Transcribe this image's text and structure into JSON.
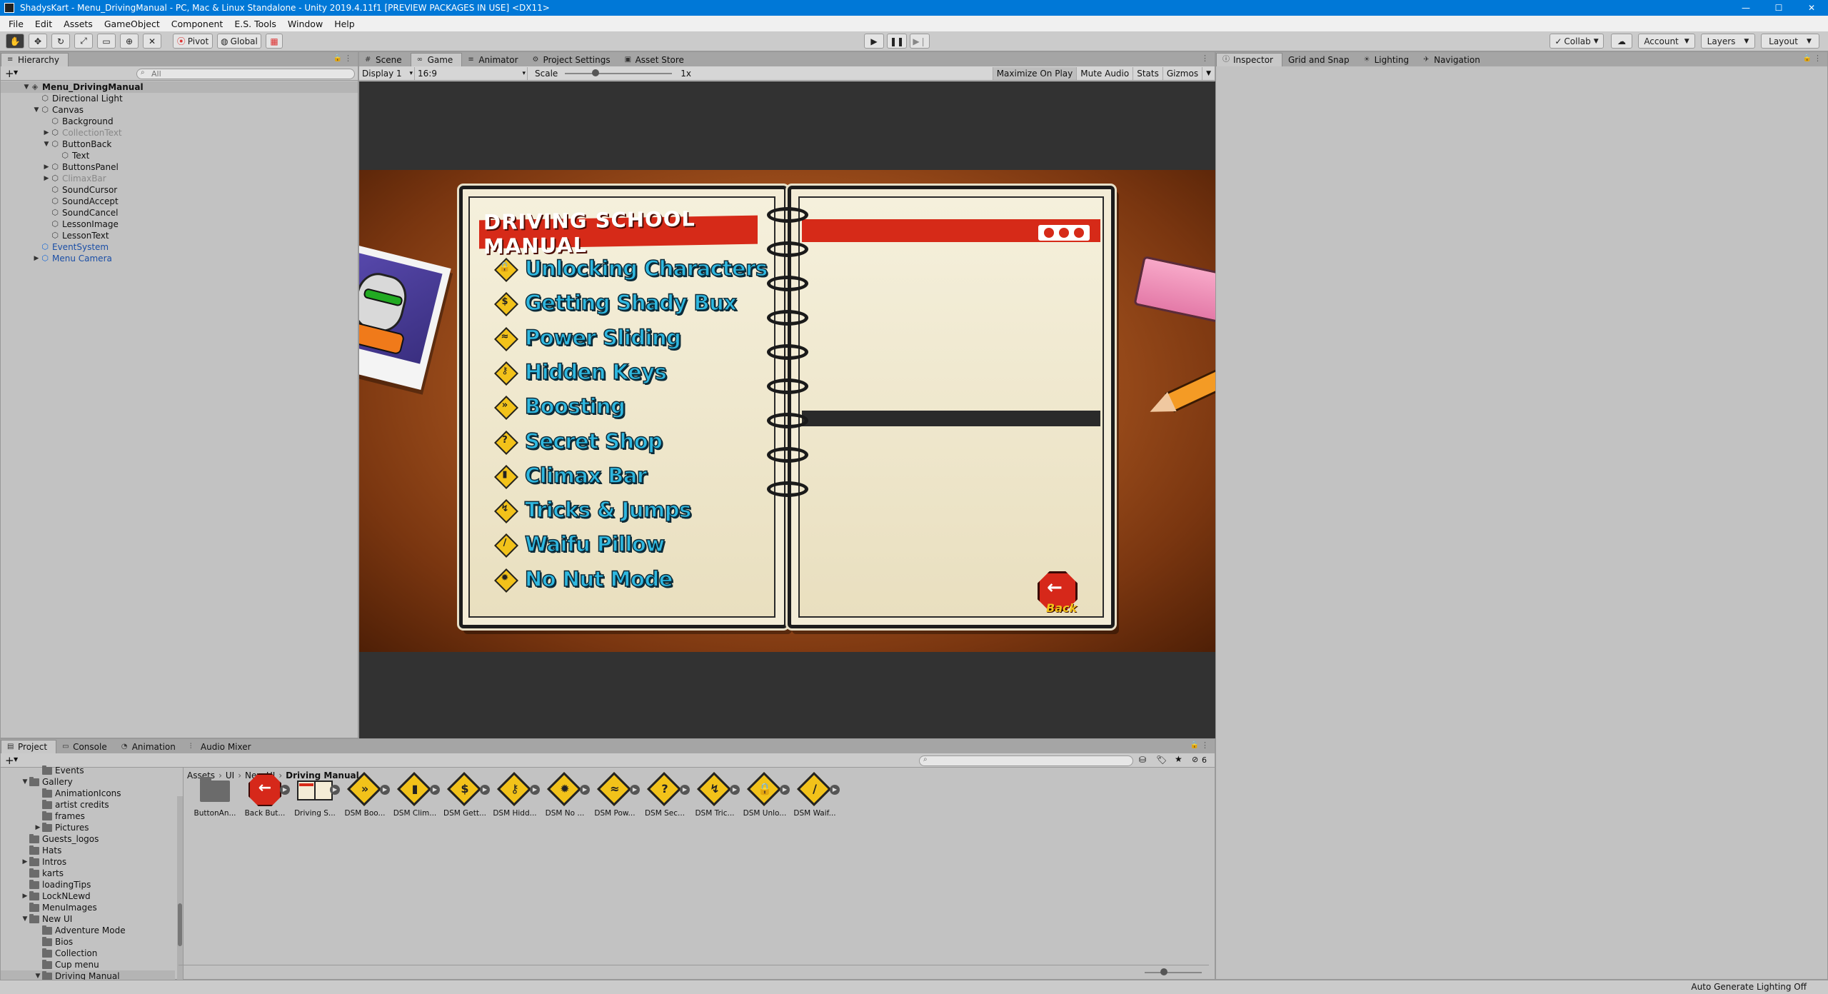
{
  "window": {
    "title": "ShadysKart - Menu_DrivingManual - PC, Mac & Linux Standalone - Unity 2019.4.11f1 [PREVIEW PACKAGES IN USE] <DX11>",
    "minimize": "—",
    "maximize": "☐",
    "close": "✕"
  },
  "menu": [
    "File",
    "Edit",
    "Assets",
    "GameObject",
    "Component",
    "E.S. Tools",
    "Window",
    "Help"
  ],
  "toolbar": {
    "pivot": "Pivot",
    "global": "Global",
    "collab": "Collab",
    "account": "Account",
    "layers": "Layers",
    "layout": "Layout"
  },
  "hierarchy": {
    "tab": "Hierarchy",
    "search_placeholder": "All",
    "add": "+",
    "items": [
      {
        "label": "Menu_DrivingManual",
        "depth": 0,
        "arrow": "▼",
        "state": "scene"
      },
      {
        "label": "Directional Light",
        "depth": 1,
        "arrow": "",
        "state": "normal"
      },
      {
        "label": "Canvas",
        "depth": 1,
        "arrow": "▼",
        "state": "normal"
      },
      {
        "label": "Background",
        "depth": 2,
        "arrow": "",
        "state": "normal"
      },
      {
        "label": "CollectionText",
        "depth": 2,
        "arrow": "▶",
        "state": "disabled"
      },
      {
        "label": "ButtonBack",
        "depth": 2,
        "arrow": "▼",
        "state": "normal"
      },
      {
        "label": "Text",
        "depth": 3,
        "arrow": "",
        "state": "normal"
      },
      {
        "label": "ButtonsPanel",
        "depth": 2,
        "arrow": "▶",
        "state": "normal"
      },
      {
        "label": "ClimaxBar",
        "depth": 2,
        "arrow": "▶",
        "state": "disabled"
      },
      {
        "label": "SoundCursor",
        "depth": 2,
        "arrow": "",
        "state": "normal"
      },
      {
        "label": "SoundAccept",
        "depth": 2,
        "arrow": "",
        "state": "normal"
      },
      {
        "label": "SoundCancel",
        "depth": 2,
        "arrow": "",
        "state": "normal"
      },
      {
        "label": "LessonImage",
        "depth": 2,
        "arrow": "",
        "state": "normal"
      },
      {
        "label": "LessonText",
        "depth": 2,
        "arrow": "",
        "state": "normal"
      },
      {
        "label": "EventSystem",
        "depth": 1,
        "arrow": "",
        "state": "prefab"
      },
      {
        "label": "Menu Camera",
        "depth": 1,
        "arrow": "▶",
        "state": "prefab"
      }
    ]
  },
  "center_tabs": [
    {
      "label": "Scene",
      "icon": "#",
      "active": false
    },
    {
      "label": "Game",
      "icon": "∞",
      "active": true
    },
    {
      "label": "Animator",
      "icon": "≡",
      "active": false
    },
    {
      "label": "Project Settings",
      "icon": "⚙",
      "active": false
    },
    {
      "label": "Asset Store",
      "icon": "▣",
      "active": false
    }
  ],
  "gamebar": {
    "display": "Display 1",
    "aspect": "16:9",
    "scale_label": "Scale",
    "scale_value": "1x",
    "maximize": "Maximize On Play",
    "mute": "Mute Audio",
    "stats": "Stats",
    "gizmos": "Gizmos"
  },
  "game": {
    "title": "DRIVING SCHOOL MANUAL",
    "lessons": [
      {
        "label": "Unlocking Characters",
        "glyph": "🔒"
      },
      {
        "label": "Getting Shady Bux",
        "glyph": "$"
      },
      {
        "label": "Power Sliding",
        "glyph": "≈"
      },
      {
        "label": "Hidden Keys",
        "glyph": "⚷"
      },
      {
        "label": "Boosting",
        "glyph": "»"
      },
      {
        "label": "Secret Shop",
        "glyph": "?"
      },
      {
        "label": "Climax Bar",
        "glyph": "▮"
      },
      {
        "label": "Tricks & Jumps",
        "glyph": "↯"
      },
      {
        "label": "Waifu Pillow",
        "glyph": "/"
      },
      {
        "label": "No Nut Mode",
        "glyph": "✹"
      }
    ],
    "back_label": "Back"
  },
  "inspector_tabs": [
    {
      "label": "Inspector",
      "icon": "ⓘ",
      "active": true
    },
    {
      "label": "Grid and Snap",
      "icon": "",
      "active": false
    },
    {
      "label": "Lighting",
      "icon": "☀",
      "active": false
    },
    {
      "label": "Navigation",
      "icon": "✈",
      "active": false
    }
  ],
  "bottom_tabs": [
    {
      "label": "Project",
      "icon": "▤",
      "active": true
    },
    {
      "label": "Console",
      "icon": "▭",
      "active": false
    },
    {
      "label": "Animation",
      "icon": "◔",
      "active": false
    },
    {
      "label": "Audio Mixer",
      "icon": "⫶",
      "active": false
    }
  ],
  "project": {
    "hidden_count": "6",
    "tree": [
      {
        "label": "Events",
        "depth": 2,
        "arrow": ""
      },
      {
        "label": "Gallery",
        "depth": 1,
        "arrow": "▼"
      },
      {
        "label": "AnimationIcons",
        "depth": 2,
        "arrow": ""
      },
      {
        "label": "artist credits",
        "depth": 2,
        "arrow": ""
      },
      {
        "label": "frames",
        "depth": 2,
        "arrow": ""
      },
      {
        "label": "Pictures",
        "depth": 2,
        "arrow": "▶"
      },
      {
        "label": "Guests_logos",
        "depth": 1,
        "arrow": ""
      },
      {
        "label": "Hats",
        "depth": 1,
        "arrow": ""
      },
      {
        "label": "Intros",
        "depth": 1,
        "arrow": "▶"
      },
      {
        "label": "karts",
        "depth": 1,
        "arrow": ""
      },
      {
        "label": "loadingTips",
        "depth": 1,
        "arrow": ""
      },
      {
        "label": "LockNLewd",
        "depth": 1,
        "arrow": "▶"
      },
      {
        "label": "MenuImages",
        "depth": 1,
        "arrow": ""
      },
      {
        "label": "New UI",
        "depth": 1,
        "arrow": "▼"
      },
      {
        "label": "Adventure Mode",
        "depth": 2,
        "arrow": ""
      },
      {
        "label": "Bios",
        "depth": 2,
        "arrow": ""
      },
      {
        "label": "Collection",
        "depth": 2,
        "arrow": ""
      },
      {
        "label": "Cup menu",
        "depth": 2,
        "arrow": ""
      },
      {
        "label": "Driving Manual",
        "depth": 2,
        "arrow": "▼"
      }
    ],
    "breadcrumb": [
      "Assets",
      "UI",
      "New UI",
      "Driving Manual"
    ],
    "assets": [
      {
        "label": "ButtonAn...",
        "kind": "folder",
        "glyph": ""
      },
      {
        "label": "Back But...",
        "kind": "stop",
        "glyph": "←"
      },
      {
        "label": "Driving S...",
        "kind": "book",
        "glyph": ""
      },
      {
        "label": "DSM Boo...",
        "kind": "diamond",
        "glyph": "»"
      },
      {
        "label": "DSM Clim...",
        "kind": "diamond",
        "glyph": "▮"
      },
      {
        "label": "DSM Gett...",
        "kind": "diamond",
        "glyph": "$"
      },
      {
        "label": "DSM Hidd...",
        "kind": "diamond",
        "glyph": "⚷"
      },
      {
        "label": "DSM No ...",
        "kind": "diamond",
        "glyph": "✹"
      },
      {
        "label": "DSM Pow...",
        "kind": "diamond",
        "glyph": "≈"
      },
      {
        "label": "DSM Sec...",
        "kind": "diamond",
        "glyph": "?"
      },
      {
        "label": "DSM Tric...",
        "kind": "diamond",
        "glyph": "↯"
      },
      {
        "label": "DSM Unlo...",
        "kind": "diamond",
        "glyph": "🔒"
      },
      {
        "label": "DSM Waif...",
        "kind": "diamond",
        "glyph": "/"
      }
    ]
  },
  "status": {
    "right": "Auto Generate Lighting Off"
  },
  "colors": {
    "accent": "#0078d7",
    "lesson_text": "#2fb8e0",
    "manual_red": "#d62a18",
    "sign_yellow": "#f2c21a"
  }
}
